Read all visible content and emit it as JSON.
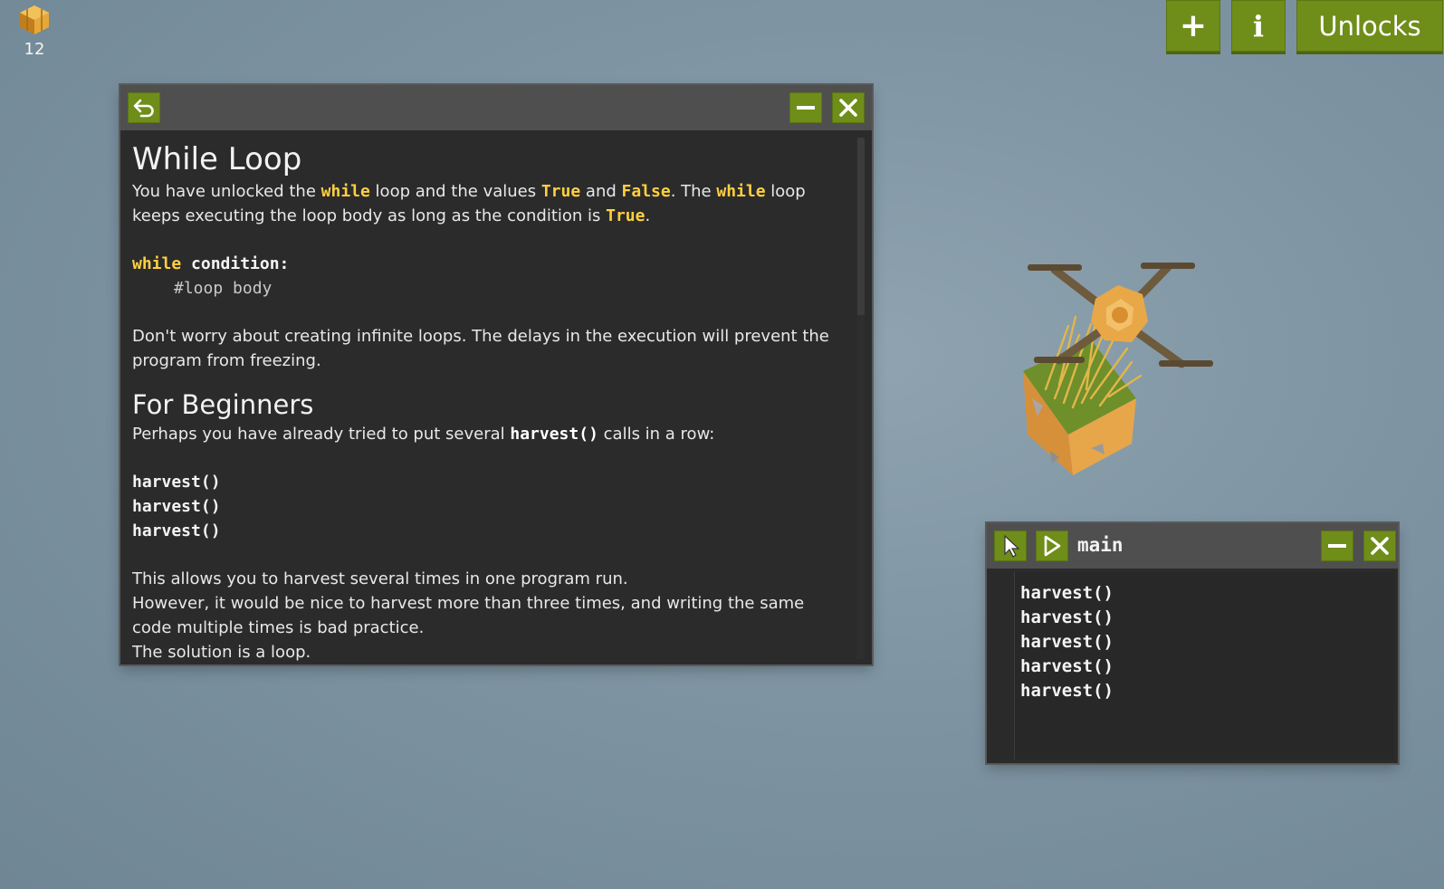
{
  "resources": {
    "hay_count": "12"
  },
  "top_buttons": {
    "add": "+",
    "info": "i",
    "unlocks": "Unlocks"
  },
  "docs": {
    "title": "While Loop",
    "intro": {
      "t1": "You have unlocked the ",
      "k1": "while",
      "t2": " loop and the values ",
      "k2": "True",
      "t3": " and ",
      "k3": "False",
      "t4": ". The ",
      "k4": "while",
      "t5": " loop keeps executing the loop body as long as the condition is ",
      "k5": "True",
      "t6": "."
    },
    "example": {
      "kw": "while",
      "cond": " condition:",
      "comment": "#loop body"
    },
    "infinite_note": "Don't worry about creating infinite loops. The delays in the execution will prevent the program from freezing.",
    "beginners_heading": "For Beginners",
    "beginners_text": {
      "t1": "Perhaps you have already tried to put several ",
      "fn": "harvest()",
      "t2": " calls in a row:"
    },
    "harvest_lines": [
      "harvest()",
      "harvest()",
      "harvest()"
    ],
    "after_1": "This allows you to harvest several times in one program run.",
    "after_2": "However, it would be nice to harvest more than three times, and writing the same code multiple times is bad practice.",
    "after_3": "The solution is a loop."
  },
  "main_window": {
    "title": "main",
    "code_lines": [
      "harvest()",
      "harvest()",
      "harvest()",
      "harvest()",
      "harvest()"
    ]
  },
  "colors": {
    "button_green": "#6f8d19",
    "keyword_yellow": "#ffd040",
    "panel_bg": "#2b2b2b"
  }
}
